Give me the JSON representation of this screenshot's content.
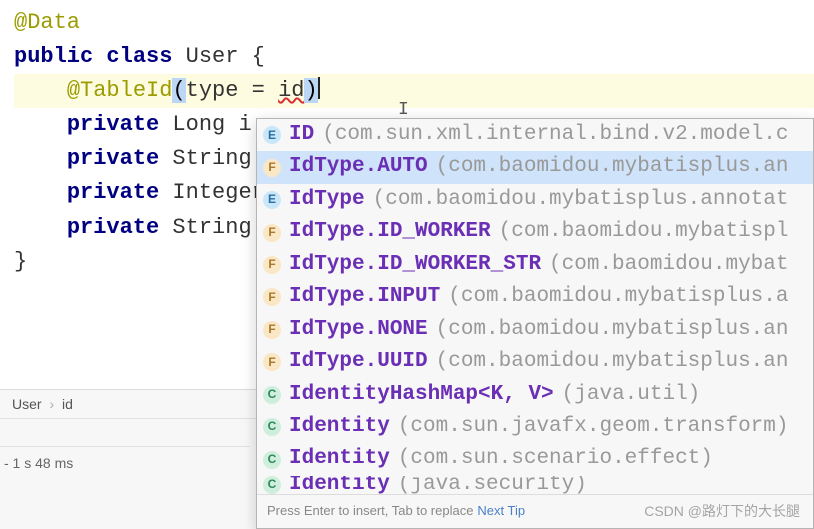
{
  "code": {
    "line1_ann": "@Data",
    "line2_kw1": "public",
    "line2_kw2": "class",
    "line2_rest": " User {",
    "line3_ann": "@TableId",
    "line3_open": "(",
    "line3_type": "type = ",
    "line3_typed": "id",
    "line3_closesel": ")",
    "line4_kw": "private",
    "line4_rest": " Long i",
    "line5_kw": "private",
    "line5_rest": " String",
    "line6_kw": "private",
    "line6_rest": " Integer",
    "line7_kw": "private",
    "line7_rest": " String",
    "line8": "}"
  },
  "breadcrumb": {
    "seg1": "User",
    "seg2": "id",
    "sep": "›"
  },
  "status": {
    "text": "- 1 s 48 ms"
  },
  "popup": {
    "items": [
      {
        "icon": "e",
        "name": "ID",
        "tail": " (com.sun.xml.internal.bind.v2.model.c"
      },
      {
        "icon": "f",
        "name": "IdType.AUTO",
        "tail": " (com.baomidou.mybatisplus.an",
        "hl": true
      },
      {
        "icon": "e",
        "name": "IdType",
        "tail": " (com.baomidou.mybatisplus.annotat"
      },
      {
        "icon": "f",
        "name": "IdType.ID_WORKER",
        "tail": " (com.baomidou.mybatispl"
      },
      {
        "icon": "f",
        "name": "IdType.ID_WORKER_STR",
        "tail": " (com.baomidou.mybat"
      },
      {
        "icon": "f",
        "name": "IdType.INPUT",
        "tail": " (com.baomidou.mybatisplus.a"
      },
      {
        "icon": "f",
        "name": "IdType.NONE",
        "tail": " (com.baomidou.mybatisplus.an"
      },
      {
        "icon": "f",
        "name": "IdType.UUID",
        "tail": " (com.baomidou.mybatisplus.an"
      },
      {
        "icon": "c",
        "name": "IdentityHashMap<K, V>",
        "tail": " (java.util)"
      },
      {
        "icon": "c",
        "name": "Identity",
        "tail": " (com.sun.javafx.geom.transform)"
      },
      {
        "icon": "c",
        "name": "Identity",
        "tail": " (com.sun.scenario.effect)"
      },
      {
        "icon": "c",
        "name": "Identity",
        "tail": " (java.security)",
        "cut": true
      }
    ],
    "hint_text": "Press Enter to insert, Tab to replace",
    "hint_link": "Next Tip"
  },
  "watermark": "CSDN @路灯下的大长腿"
}
